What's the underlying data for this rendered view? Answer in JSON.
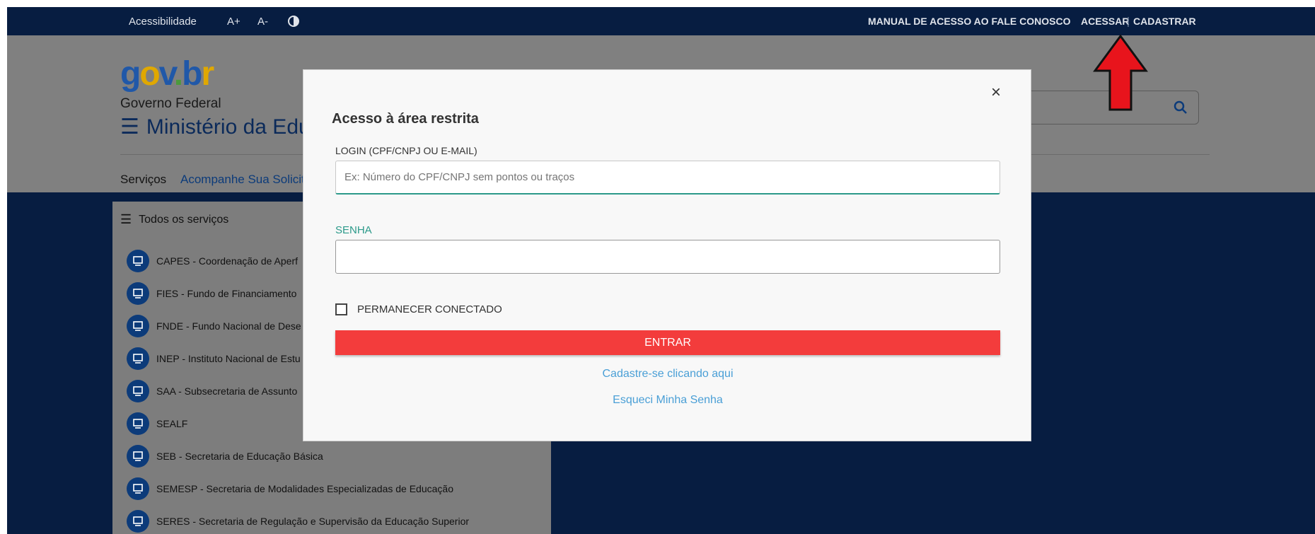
{
  "topbar": {
    "accessibility": "Acessibilidade",
    "font_increase": "A+",
    "font_decrease": "A-",
    "manual_link": "MANUAL DE ACESSO AO FALE CONOSCO",
    "acessar": "ACESSAR",
    "cadastrar": "CADASTRAR",
    "separator": "|"
  },
  "header": {
    "logo_text": "gov.br",
    "government": "Governo Federal",
    "ministry": "Ministério da Edu",
    "nav": [
      "Serviços",
      "Acompanhe Sua Solicita"
    ]
  },
  "sidebar": {
    "title": "Todos os serviços",
    "items": [
      "CAPES - Coordenação de Aperf",
      "FIES - Fundo de Financiamento",
      "FNDE - Fundo Nacional de Dese",
      "INEP - Instituto Nacional de Estu",
      "SAA - Subsecretaria de Assunto",
      "SEALF",
      "SEB - Secretaria de Educação Básica",
      "SEMESP - Secretaria de Modalidades Especializadas de Educação",
      "SERES - Secretaria de Regulação e Supervisão da Educação Superior"
    ]
  },
  "modal": {
    "title": "Acesso à área restrita",
    "close": "×",
    "login_label": "LOGIN (CPF/CNPJ OU E-MAIL)",
    "login_placeholder": "Ex: Número do CPF/CNPJ sem pontos ou traços",
    "password_label": "SENHA",
    "remember_label": "PERMANECER CONECTADO",
    "submit": "ENTRAR",
    "register_link": "Cadastre-se clicando aqui",
    "forgot_link": "Esqueci Minha Senha"
  },
  "colors": {
    "topbar_bg": "#071d41",
    "overlay_gray": "#808080",
    "submit_red": "#f33c3c",
    "link_blue": "#4a9fd6",
    "accent_teal": "#2c9a8a",
    "arrow_red": "#e8141c"
  },
  "icons": [
    "contrast-icon",
    "search-icon",
    "menu-icon",
    "monitor-icon",
    "close-icon",
    "red-arrow-annotation"
  ]
}
